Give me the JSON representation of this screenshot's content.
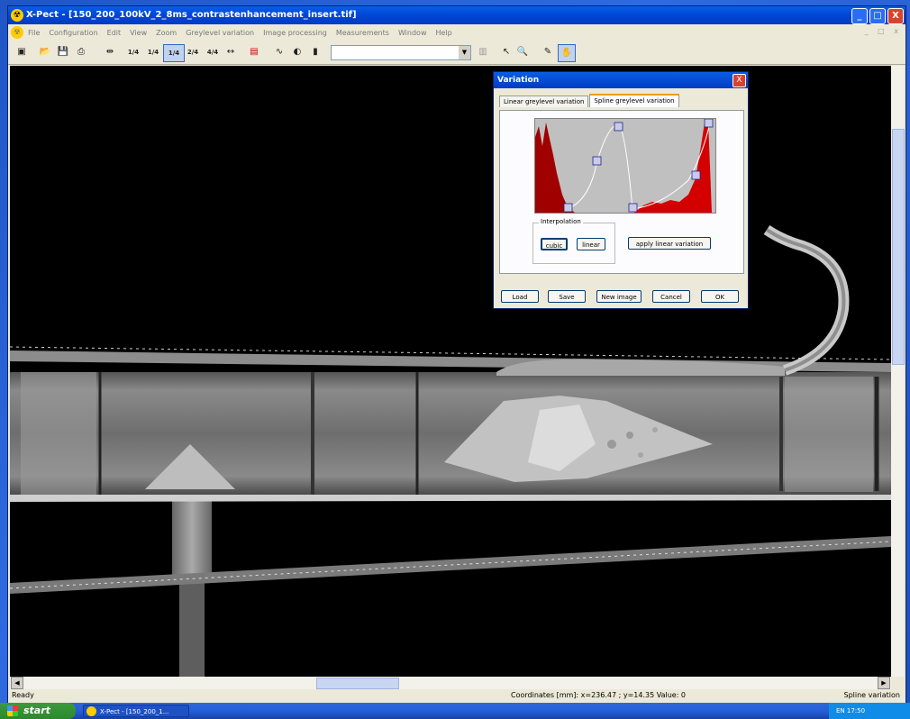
{
  "window": {
    "title": "X-Pect - [150_200_100kV_2_8ms_contrastenhancement_insert.tif]",
    "controls": {
      "minimize": "_",
      "maximize": "□",
      "close": "X"
    }
  },
  "menubar": {
    "items": [
      "File",
      "Configuration",
      "Edit",
      "View",
      "Zoom",
      "Greylevel variation",
      "Image processing",
      "Measurements",
      "Window",
      "Help"
    ],
    "mdi_controls": "_ □ x"
  },
  "toolbar": {
    "zoom_labels": [
      "1/4",
      "1/4",
      "1/4",
      "2/4",
      "4/4"
    ]
  },
  "dialog": {
    "title": "Variation",
    "close": "X",
    "tabs": [
      "Linear greylevel variation",
      "Spline greylevel variation"
    ],
    "active_tab": 1,
    "interpolation_label": "Interpolation",
    "cubic_label": "cubic",
    "linear_label": "linear",
    "apply_label": "apply linear variation",
    "buttons": {
      "load": "Load",
      "save": "Save",
      "new_image": "New image",
      "cancel": "Cancel",
      "ok": "OK"
    }
  },
  "status": {
    "left": "Ready",
    "coords": "Coordinates [mm]:  x=236.47 ;  y=14.35    Value: 0",
    "mode": "Spline variation"
  },
  "taskbar": {
    "start": "start",
    "task": "X-Pect - [150_200_1...",
    "tray": "EN   17:50"
  },
  "colors": {
    "title": "#0046d6",
    "histogram_fill": "#b00000",
    "canvas": "#000000"
  }
}
